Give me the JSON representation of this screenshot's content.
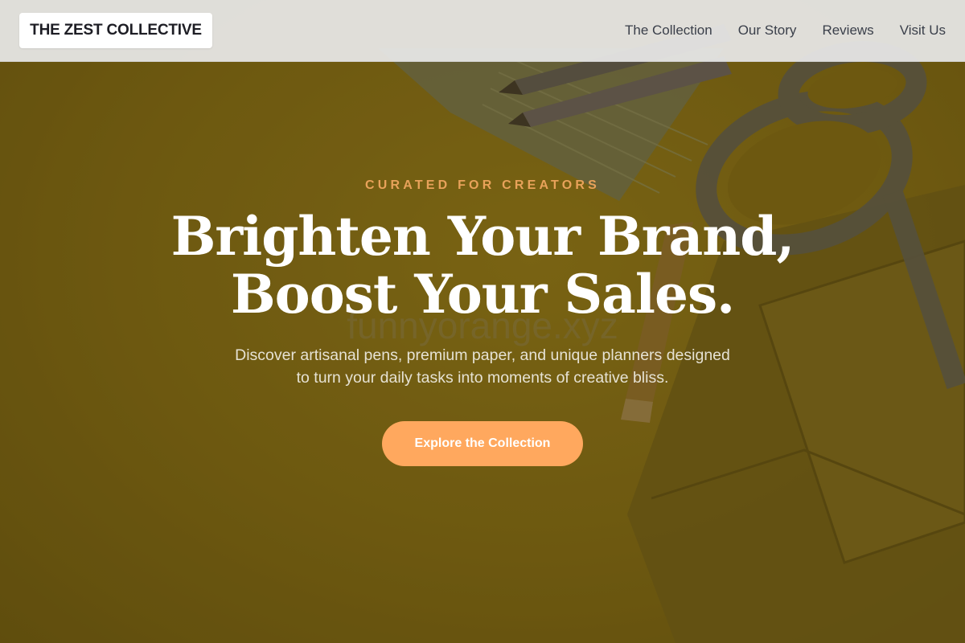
{
  "header": {
    "logo_text": "THE ZEST COLLECTIVE",
    "nav": [
      {
        "label": "The Collection"
      },
      {
        "label": "Our Story"
      },
      {
        "label": "Reviews"
      },
      {
        "label": "Visit Us"
      }
    ]
  },
  "hero": {
    "eyebrow": "CURATED FOR CREATORS",
    "headline_line1": "Brighten Your Brand,",
    "headline_line2": "Boost Your Sales.",
    "watermark": "funnyorange.xyz",
    "subtext_line1": "Discover artisanal pens, premium paper, and unique planners designed",
    "subtext_line2": "to turn your daily tasks into moments of creative bliss.",
    "cta_label": "Explore the Collection"
  },
  "colors": {
    "accent": "#ffa85e",
    "eyebrow": "#e8a25a",
    "hero_overlay": "#6e5a12",
    "header_bg": "#e8e8e8",
    "headline": "#ffffff"
  }
}
